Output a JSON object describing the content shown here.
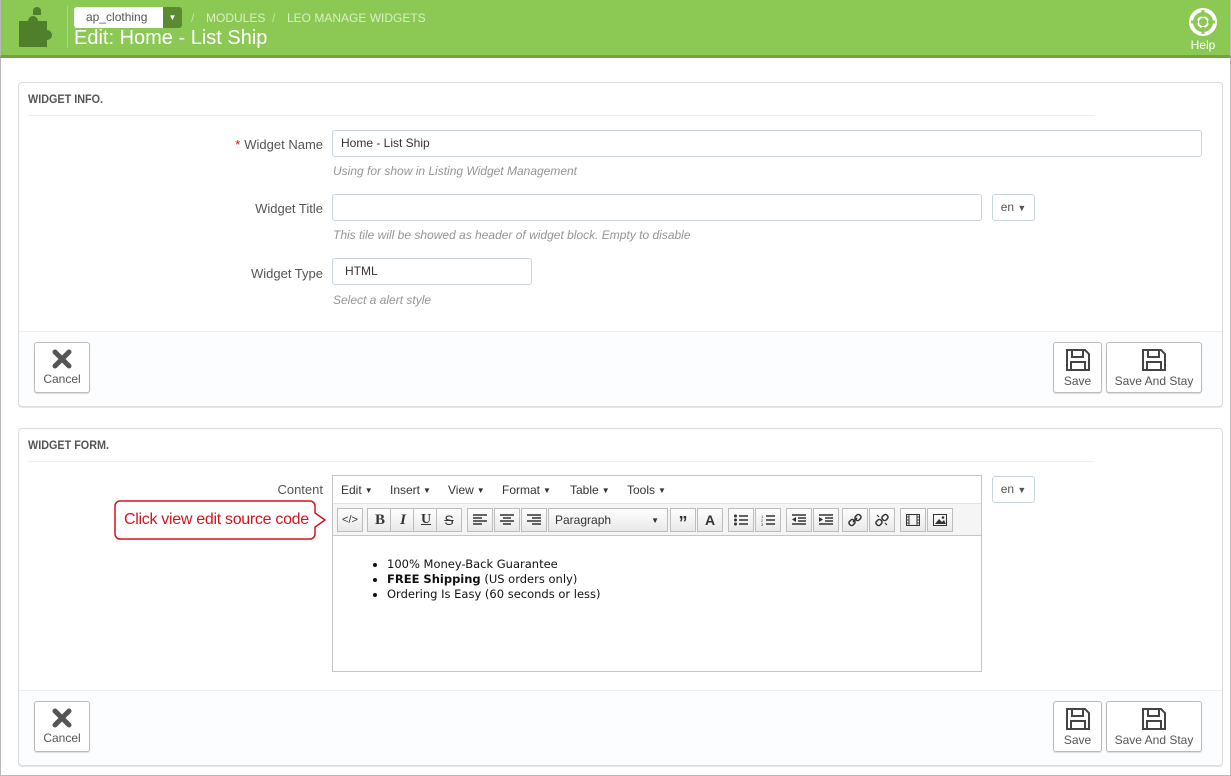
{
  "header": {
    "shop_name": "ap_clothing",
    "breadcrumb_1": "MODULES",
    "breadcrumb_2": "LEO MANAGE WIDGETS",
    "breadcrumb_sep": "/",
    "title": "Edit: Home - List Ship",
    "help_label": "Help",
    "accent_color": "#8bc954"
  },
  "widget_info": {
    "heading": "WIDGET INFO.",
    "name_label": "Widget Name",
    "name_required_mark": "*",
    "name_value": "Home - List Ship",
    "name_help": "Using for show in Listing Widget Management",
    "title_label": "Widget Title",
    "title_value": "",
    "title_help": "This tile will be showed as header of widget block. Empty to disable",
    "lang": "en",
    "type_label": "Widget Type",
    "type_value": "HTML",
    "type_help": "Select a alert style",
    "cancel_label": "Cancel",
    "save_label": "Save",
    "save_stay_label": "Save And Stay"
  },
  "widget_form": {
    "heading": "WIDGET FORM.",
    "content_label": "Content",
    "lang": "en",
    "menu": [
      "Edit",
      "Insert",
      "View",
      "Format",
      "Table",
      "Tools"
    ],
    "paragraph_select": "Paragraph",
    "list_items": [
      {
        "bold": "",
        "text": "100% Money-Back Guarantee"
      },
      {
        "bold": "FREE Shipping",
        "text": " (US orders only)"
      },
      {
        "bold": "",
        "text": "Ordering Is Easy (60 seconds or less)"
      }
    ],
    "cancel_label": "Cancel",
    "save_label": "Save",
    "save_stay_label": "Save And Stay"
  },
  "callout": {
    "text": "Click view edit source code",
    "color": "#d4141a"
  }
}
